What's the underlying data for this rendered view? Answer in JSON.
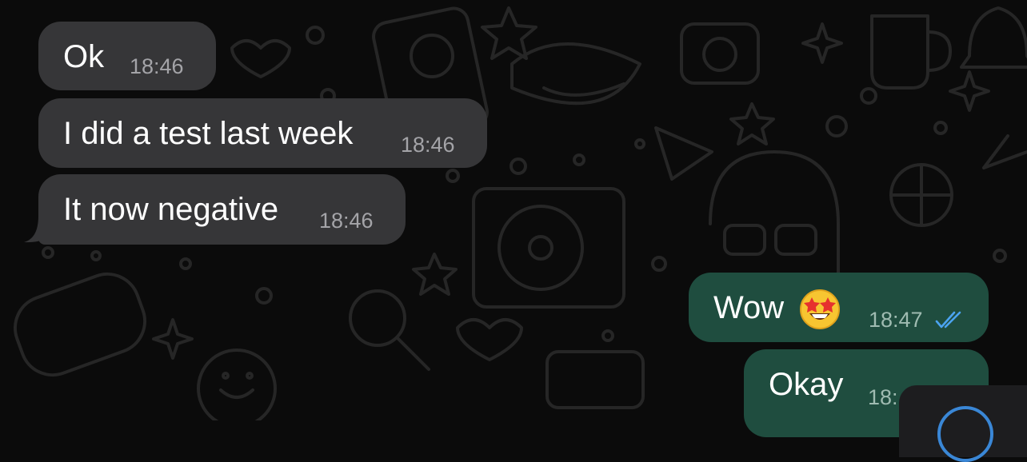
{
  "messages": [
    {
      "direction": "incoming",
      "text": "Ok",
      "time": "18:46"
    },
    {
      "direction": "incoming",
      "text": "I did a test last week",
      "time": "18:46"
    },
    {
      "direction": "incoming",
      "text": "It now negative",
      "time": "18:46"
    },
    {
      "direction": "outgoing",
      "text": "Wow",
      "emoji": "star-struck",
      "time": "18:47",
      "status": "read"
    },
    {
      "direction": "outgoing",
      "text": "Okay",
      "time": "18:"
    }
  ],
  "colors": {
    "background": "#0b0b0b",
    "incoming_bubble": "#363638",
    "outgoing_bubble": "#1f4d3f",
    "read_ticks": "#4ba3f0"
  }
}
